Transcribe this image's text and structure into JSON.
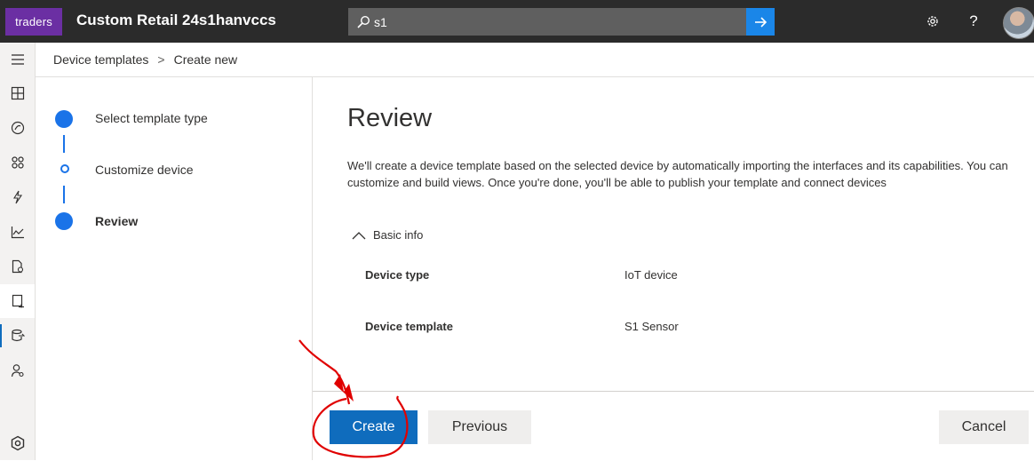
{
  "topbar": {
    "logo_text": "traders",
    "app_title": "Custom Retail 24s1hanvccs",
    "search_value": "s1",
    "search_go_icon": "arrow-right-icon",
    "settings_icon": "gear-icon",
    "help_text": "?"
  },
  "rail": {
    "items": [
      "menu-icon",
      "dashboard-icon",
      "devices-icon",
      "device-groups-icon",
      "rules-icon",
      "analytics-icon",
      "jobs-icon",
      "device-templates-icon",
      "data-export-icon",
      "users-icon",
      "settings-icon"
    ]
  },
  "breadcrumb": {
    "parent": "Device templates",
    "separator": ">",
    "current": "Create new"
  },
  "steps": [
    {
      "label": "Select template type",
      "state": "complete"
    },
    {
      "label": "Customize device",
      "state": "pending"
    },
    {
      "label": "Review",
      "state": "current"
    }
  ],
  "main": {
    "title": "Review",
    "description": "We'll create a device template based on the selected device by automatically importing the interfaces and its capabilities. You can customize and build views. Once you're done, you'll be able to publish your template and connect devices",
    "section_label": "Basic info",
    "fields": [
      {
        "label": "Device type",
        "value": "IoT device"
      },
      {
        "label": "Device template",
        "value": "S1 Sensor"
      }
    ]
  },
  "footer": {
    "create": "Create",
    "previous": "Previous",
    "cancel": "Cancel"
  },
  "colors": {
    "topbar": "#2b2b2b",
    "accent": "#0f6cbd",
    "step": "#1a73e8",
    "annotation": "#e00000"
  }
}
